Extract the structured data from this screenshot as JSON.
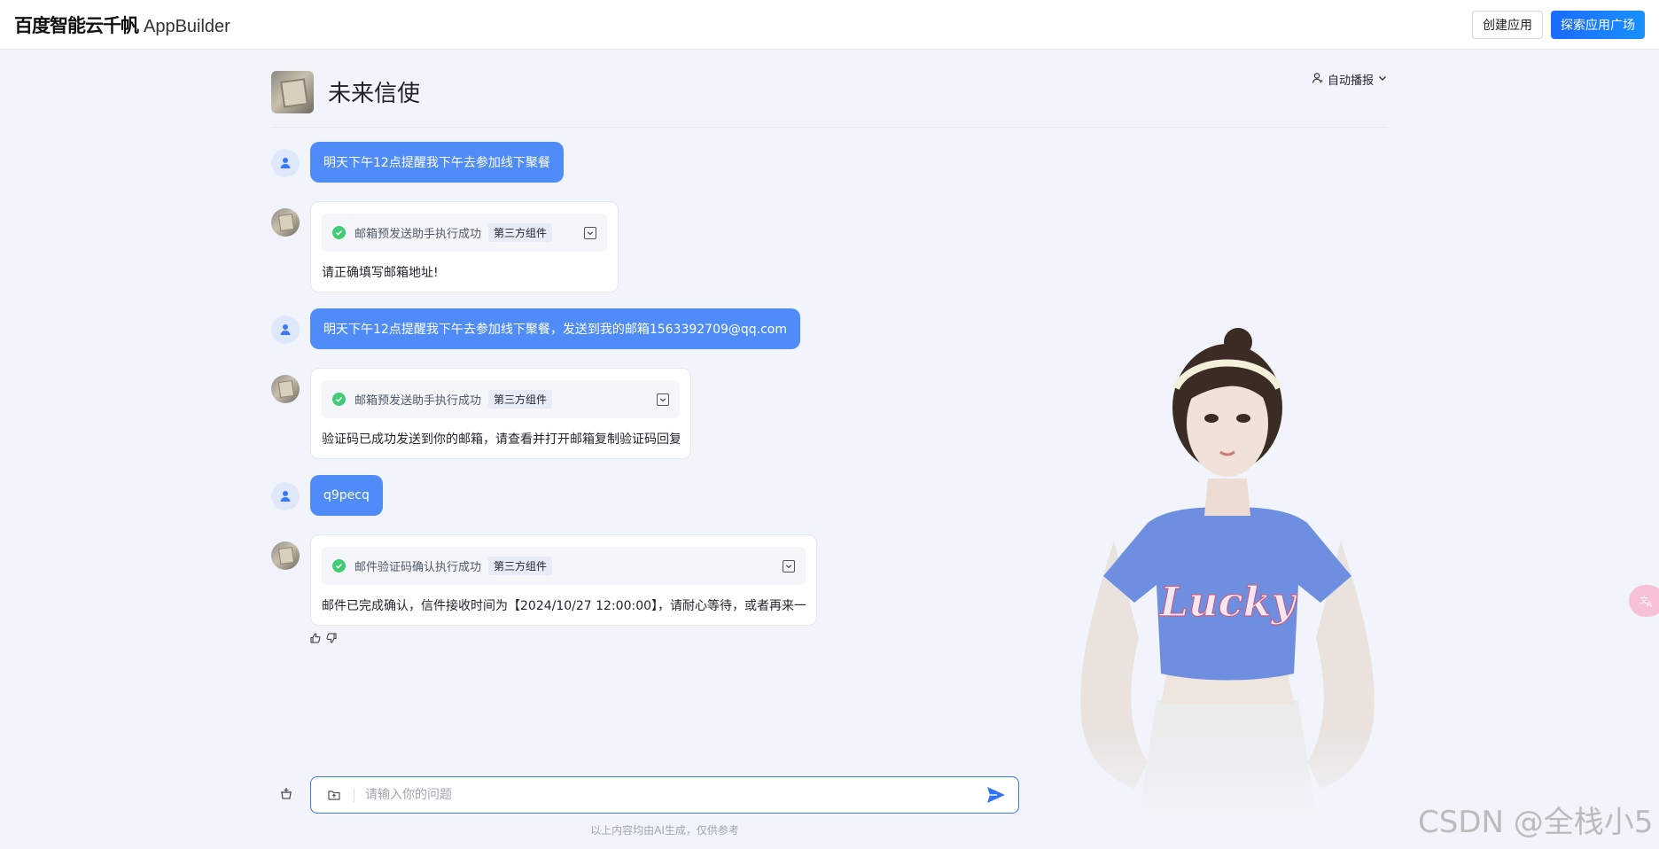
{
  "header": {
    "brand_cn": "百度智能云千帆",
    "brand_en": "AppBuilder",
    "create_label": "创建应用",
    "explore_label": "探索应用广场"
  },
  "agent": {
    "name": "未来信使",
    "autoplay_label": "自动播报"
  },
  "messages": {
    "user1": "明天下午12点提醒我下午去参加线下聚餐",
    "bot1": {
      "tool_status": "邮箱预发送助手执行成功",
      "tag": "第三方组件",
      "text": "请正确填写邮箱地址!"
    },
    "user2": "明天下午12点提醒我下午去参加线下聚餐，发送到我的邮箱1563392709@qq.com",
    "bot2": {
      "tool_status": "邮箱预发送助手执行成功",
      "tag": "第三方组件",
      "text": "验证码已成功发送到你的邮箱，请查看并打开邮箱复制验证码回复"
    },
    "user3": "q9pecq",
    "bot3": {
      "tool_status": "邮件验证码确认执行成功",
      "tag": "第三方组件",
      "text": "邮件已完成确认，信件接收时间为【2024/10/27 12:00:00】，请耐心等待，或者再来一封"
    }
  },
  "input": {
    "placeholder": "请输入你的问题"
  },
  "disclaimer": "以上内容均由AI生成，仅供参考",
  "watermark": "CSDN @全栈小5",
  "colors": {
    "primary": "#1a6bff",
    "user_bubble": "#4f8cf7",
    "background": "#f1f4fa",
    "success": "#22c55e"
  }
}
